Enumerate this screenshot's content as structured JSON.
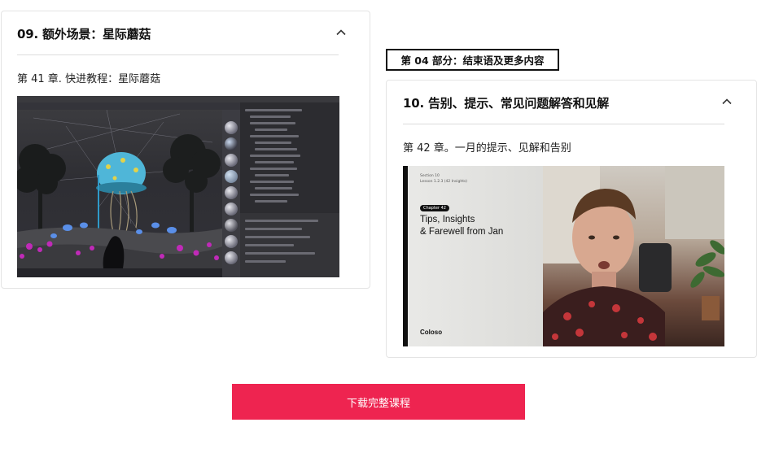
{
  "left_card": {
    "title": "09. 额外场景：星际蘑菇",
    "chapter": "第 41 章. 快进教程：星际蘑菇",
    "image_desc_icon": "collapse-chevron-up-icon"
  },
  "section": {
    "label": "第 04 部分：结束语及更多内容"
  },
  "right_card": {
    "title": "10. 告别、提示、常见问题解答和见解",
    "chapter": "第 42 章。一月的提示、见解和告别",
    "thumb": {
      "section_small": "Section 10",
      "lesson_small": "Lesson 1.2.3 (42 Insights)",
      "chip": "Chapter 42",
      "heading_line1": "Tips, Insights",
      "heading_line2": "& Farewell from Jan",
      "brand": "Coloso"
    }
  },
  "cta": {
    "label": "下载完整课程"
  },
  "colors": {
    "accent": "#ee2450",
    "border": "#e4e4e4"
  }
}
